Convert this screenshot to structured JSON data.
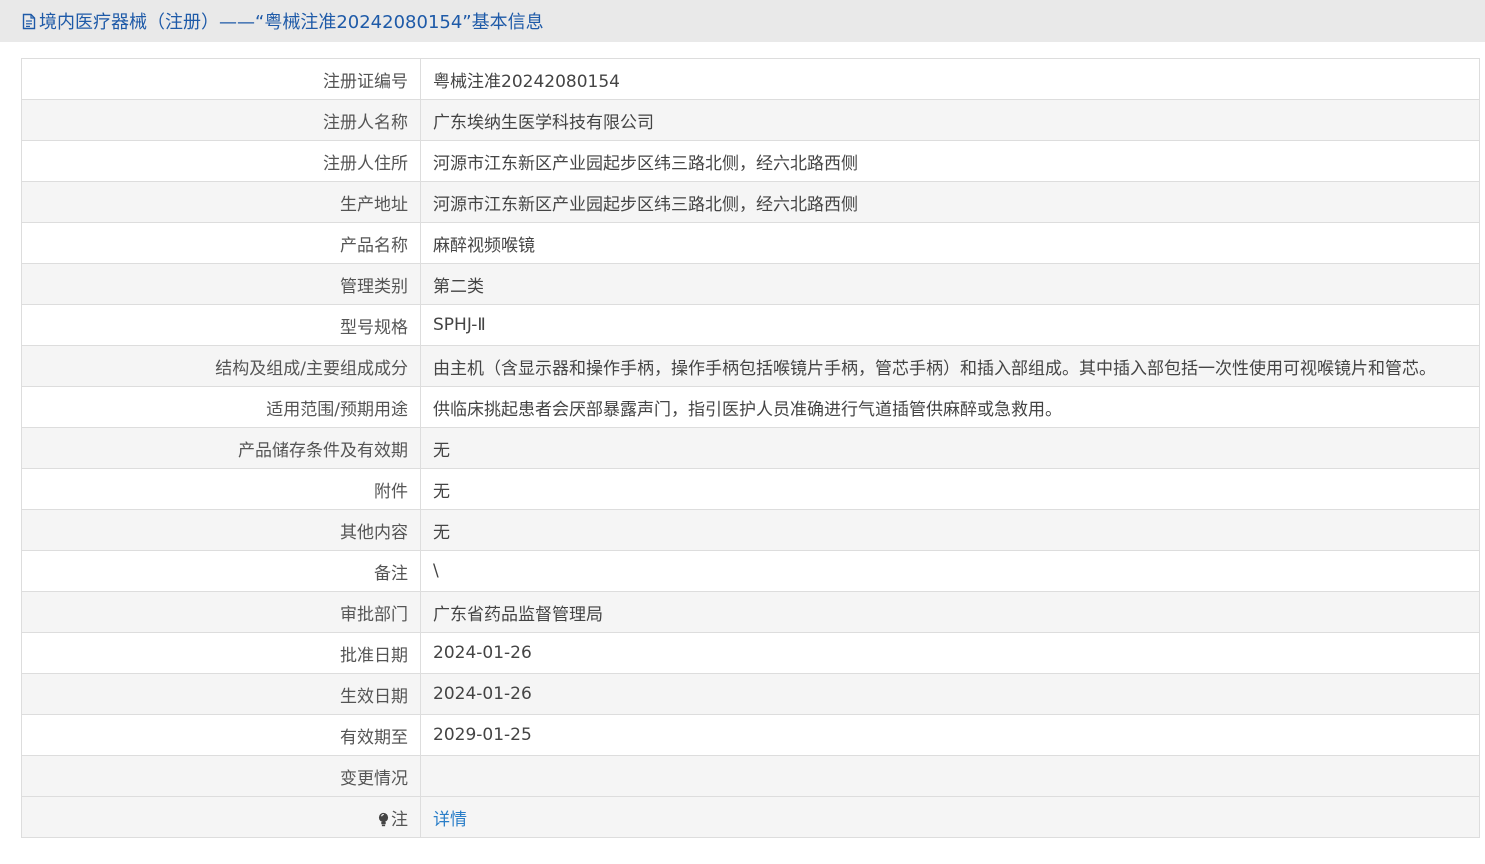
{
  "header": {
    "icon": "document-icon",
    "title": "境内医疗器械（注册）——“粤械注准20242080154”基本信息"
  },
  "rows": [
    {
      "label": "注册证编号",
      "value": "粤械注准20242080154"
    },
    {
      "label": "注册人名称",
      "value": "广东埃纳生医学科技有限公司"
    },
    {
      "label": "注册人住所",
      "value": "河源市江东新区产业园起步区纬三路北侧，经六北路西侧"
    },
    {
      "label": "生产地址",
      "value": "河源市江东新区产业园起步区纬三路北侧，经六北路西侧"
    },
    {
      "label": "产品名称",
      "value": "麻醉视频喉镜"
    },
    {
      "label": "管理类别",
      "value": "第二类"
    },
    {
      "label": "型号规格",
      "value": "SPHJ-Ⅱ"
    },
    {
      "label": "结构及组成/主要组成成分",
      "value": "由主机（含显示器和操作手柄，操作手柄包括喉镜片手柄，管芯手柄）和插入部组成。其中插入部包括一次性使用可视喉镜片和管芯。"
    },
    {
      "label": "适用范围/预期用途",
      "value": "供临床挑起患者会厌部暴露声门，指引医护人员准确进行气道插管供麻醉或急救用。"
    },
    {
      "label": "产品储存条件及有效期",
      "value": "无"
    },
    {
      "label": "附件",
      "value": "无"
    },
    {
      "label": "其他内容",
      "value": "无"
    },
    {
      "label": "备注",
      "value": "\\"
    },
    {
      "label": "审批部门",
      "value": "广东省药品监督管理局"
    },
    {
      "label": "批准日期",
      "value": "2024-01-26"
    },
    {
      "label": "生效日期",
      "value": "2024-01-26"
    },
    {
      "label": "有效期至",
      "value": "2029-01-25"
    },
    {
      "label": "变更情况",
      "value": ""
    }
  ],
  "note": {
    "icon": "lightbulb-icon",
    "label": "注",
    "link_text": "详情"
  },
  "colors": {
    "header_bg": "#e9e9e9",
    "title": "#1e5aa8",
    "link": "#2a7ec8",
    "alt_row": "#f5f5f5",
    "border": "#dddddd"
  }
}
